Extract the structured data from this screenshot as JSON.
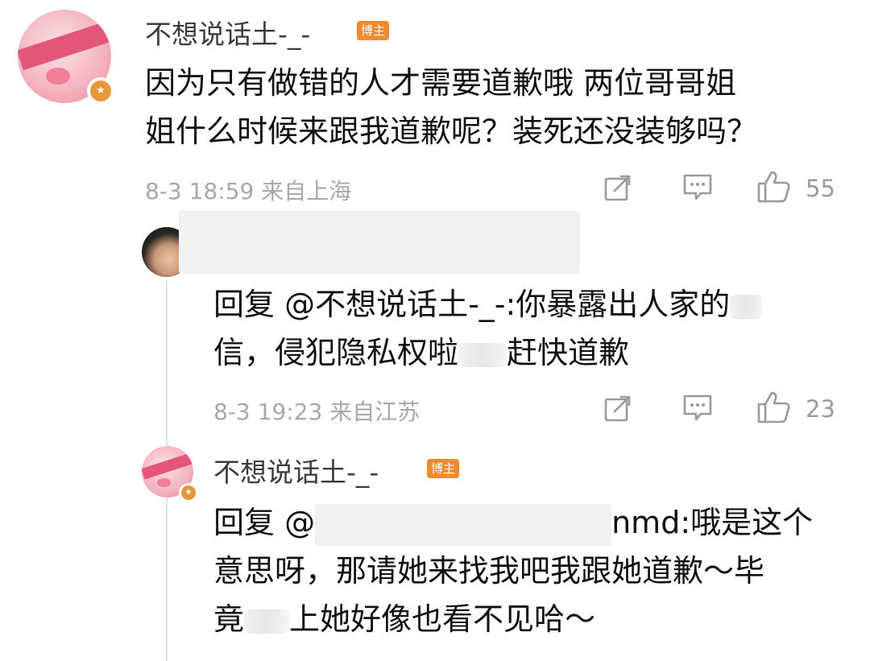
{
  "comment": {
    "username": "不想说话土-_-",
    "tag": "博主",
    "text_line1": "因为只有做错的人才需要道歉哦 两位哥哥姐",
    "text_line2": "姐什么时候来跟我道歉呢？装死还没装够吗？",
    "meta": "8-3 18:59 来自上海",
    "like_count": "55"
  },
  "reply1": {
    "text_line1": "回复 @不想说话土-_-:你暴露出人家的",
    "text_line2_a": "信，侵犯隐私权啦",
    "text_line2_b": "赶快道歉",
    "meta": "8-3 19:23 来自江苏",
    "like_count": "23"
  },
  "reply2": {
    "username": "不想说话土-_-",
    "tag": "博主",
    "text_line1_a": "回复 @",
    "text_line1_b": "nmd:哦是这个",
    "text_line2": "意思呀，那请她来找我吧我跟她道歉～毕",
    "text_line3_a": "竟",
    "text_line3_b": "上她好像也看不见哈～"
  },
  "icons": {
    "share": "share-icon",
    "comment": "comment-icon",
    "like": "thumbs-up-icon",
    "verified": "verified-badge-icon"
  },
  "colors": {
    "tag_bg": "#f08a2f",
    "meta_text": "#a8a8a8",
    "body_text": "#111111"
  }
}
